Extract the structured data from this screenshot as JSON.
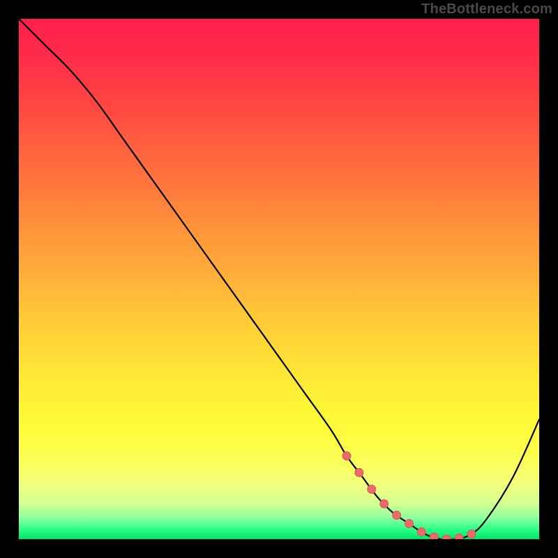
{
  "watermark": "TheBottleneck.com",
  "colors": {
    "background": "#000000",
    "curve_line": "#000000",
    "marker_fill": "#e86a6a",
    "marker_stroke": "#d85a5a",
    "gradient_top": "#ff1f4b",
    "gradient_bottom": "#00e765"
  },
  "chart_data": {
    "type": "line",
    "title": "",
    "xlabel": "",
    "ylabel": "",
    "xlim": [
      0,
      100
    ],
    "ylim": [
      0,
      100
    ],
    "x": [
      0,
      5,
      10,
      15,
      20,
      25,
      30,
      35,
      40,
      45,
      50,
      55,
      60,
      63,
      66,
      69,
      72,
      75,
      78,
      81,
      84,
      87,
      90,
      95,
      100
    ],
    "values": [
      100,
      95,
      90,
      84,
      77,
      70,
      63,
      56,
      49,
      42,
      35,
      28,
      21,
      16,
      12,
      8,
      5,
      3,
      1,
      0,
      0,
      1,
      4,
      12,
      23
    ],
    "marker_region_x": [
      63,
      87
    ],
    "notes": "Values are estimated from the image. x and y range from 0 (bottom/left edge of colored plot) to 100 (top/right edge). The curve descends roughly linearly from top-left, flattens to a minimum around x≈80, then rises toward the right edge. Thick salmon markers appear on the curve between roughly x=63 and x=87."
  }
}
